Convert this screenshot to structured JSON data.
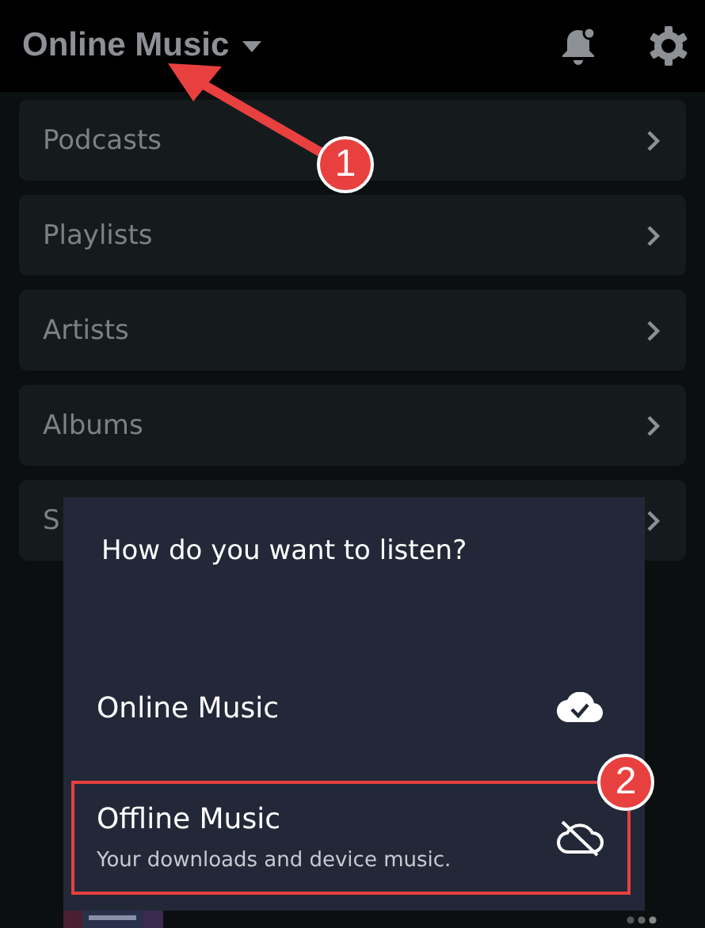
{
  "header": {
    "title": "Online Music"
  },
  "menu_items": [
    {
      "label": "Podcasts"
    },
    {
      "label": "Playlists"
    },
    {
      "label": "Artists"
    },
    {
      "label": "Albums"
    },
    {
      "label": "S"
    }
  ],
  "dialog": {
    "title": "How do you want to listen?",
    "options": [
      {
        "kind": "online",
        "label": "Online Music",
        "highlighted": false
      },
      {
        "kind": "offline",
        "label": "Offline Music",
        "description": "Your downloads and device music.",
        "highlighted": true
      }
    ]
  },
  "annotations": [
    {
      "number": "1"
    },
    {
      "number": "2"
    }
  ]
}
